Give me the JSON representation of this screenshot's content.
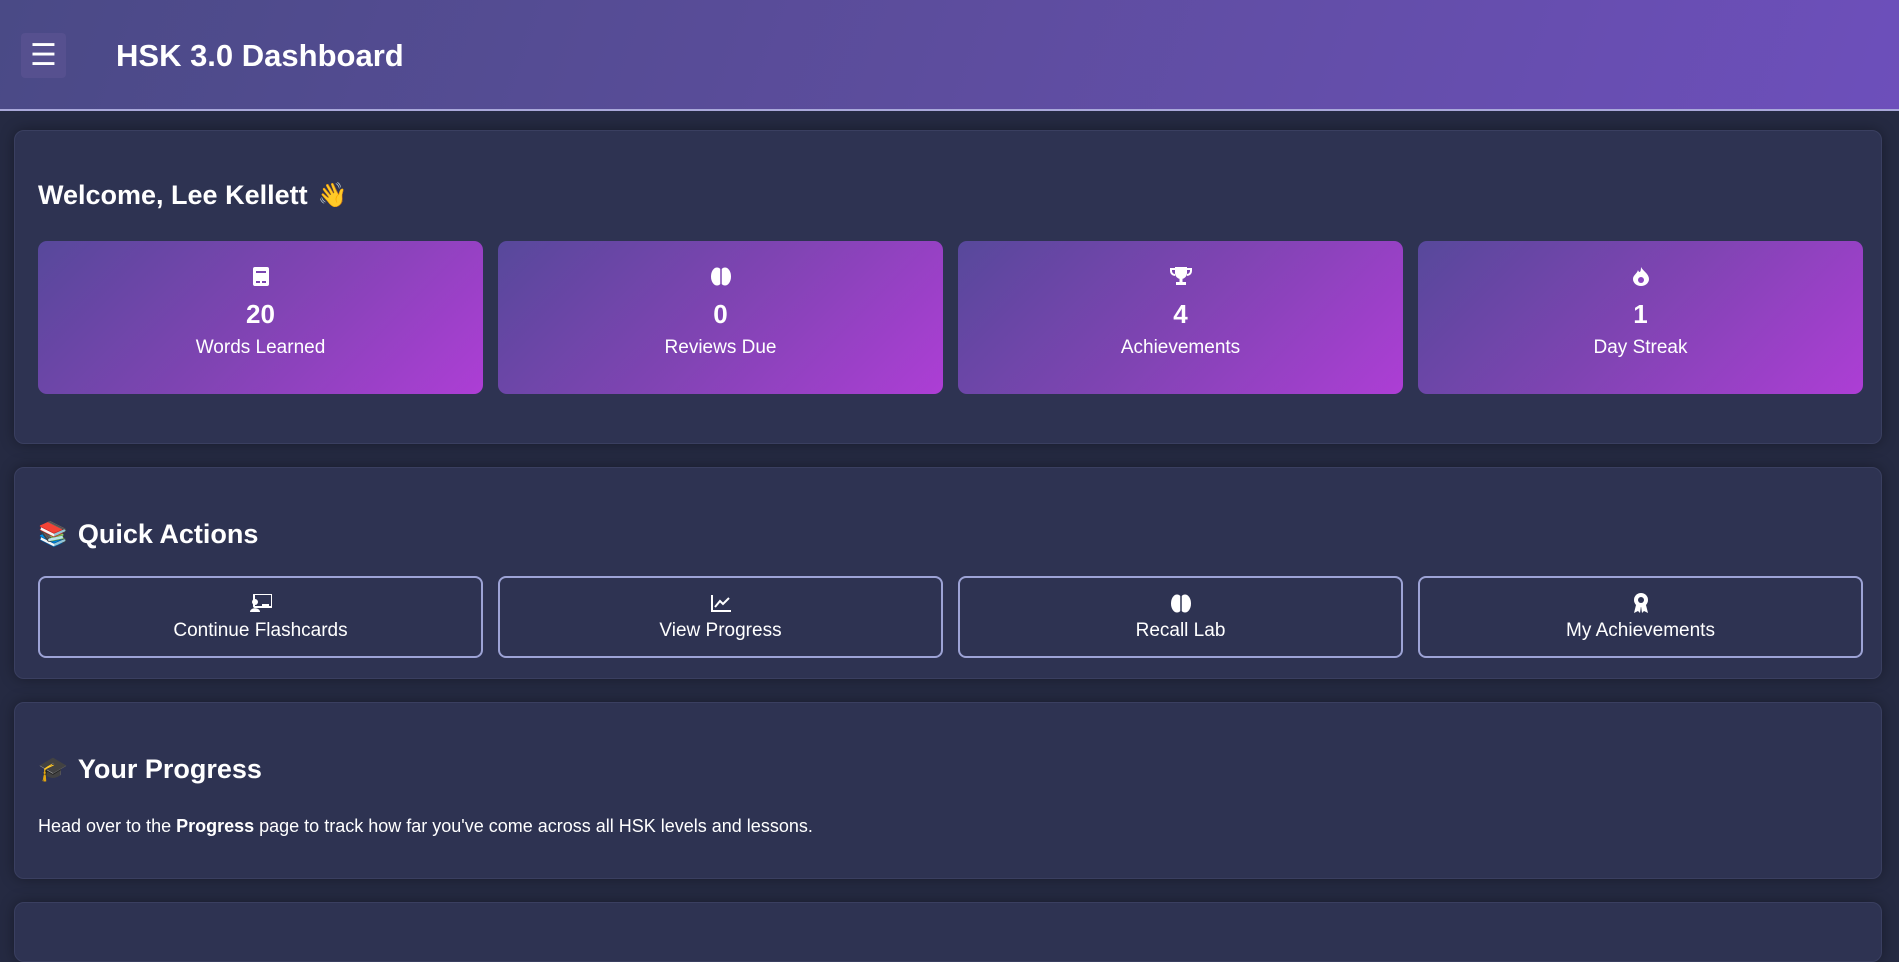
{
  "header": {
    "menu_icon": "hamburger-menu-icon",
    "menu_glyph": "☰",
    "title": "HSK 3.0 Dashboard"
  },
  "welcome": {
    "heading": "Welcome, Lee Kellett",
    "emoji": "👋",
    "stats": [
      {
        "icon": "book-icon",
        "value": "20",
        "label": "Words Learned"
      },
      {
        "icon": "brain-icon",
        "value": "0",
        "label": "Reviews Due"
      },
      {
        "icon": "trophy-icon",
        "value": "4",
        "label": "Achievements"
      },
      {
        "icon": "fire-icon",
        "value": "1",
        "label": "Day Streak"
      }
    ]
  },
  "quick_actions": {
    "heading": "Quick Actions",
    "emoji": "📚",
    "buttons": [
      {
        "icon": "presentation-icon",
        "label": "Continue Flashcards"
      },
      {
        "icon": "chart-line-icon",
        "label": "View Progress"
      },
      {
        "icon": "brain-icon",
        "label": "Recall Lab"
      },
      {
        "icon": "award-icon",
        "label": "My Achievements"
      }
    ]
  },
  "progress": {
    "heading": "Your Progress",
    "emoji": "🎓",
    "text_before": "Head over to the ",
    "text_bold": "Progress",
    "text_after": " page to track how far you've come across all HSK levels and lessons."
  },
  "colors": {
    "background": "#252a42",
    "card": "#2e3352",
    "header_start": "#4a4a86",
    "header_end": "#6d4fbb",
    "tile_start": "#57489b",
    "tile_end": "#ad3ed5",
    "button_border": "#9da3d6"
  }
}
